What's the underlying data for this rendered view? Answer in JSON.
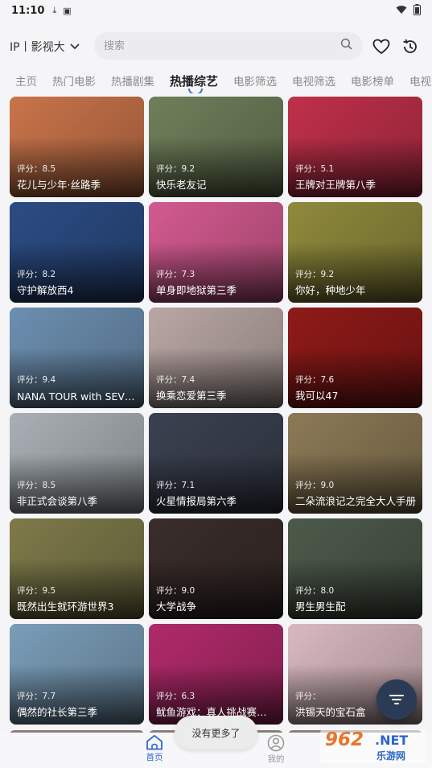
{
  "status_bar": {
    "time": "11:10"
  },
  "header": {
    "source_label": "IP丨影视大",
    "search_placeholder": "搜索"
  },
  "tabs": [
    {
      "label": "主页",
      "active": false
    },
    {
      "label": "热门电影",
      "active": false
    },
    {
      "label": "热播剧集",
      "active": false
    },
    {
      "label": "热播综艺",
      "active": true
    },
    {
      "label": "电影筛选",
      "active": false
    },
    {
      "label": "电视筛选",
      "active": false
    },
    {
      "label": "电影榜单",
      "active": false
    },
    {
      "label": "电视",
      "active": false
    }
  ],
  "cards": [
    {
      "title": "花儿与少年·丝路季",
      "rating": "评分：8.5",
      "color": "#c9744a"
    },
    {
      "title": "快乐老友记",
      "rating": "评分：9.2",
      "color": "#6f7f5a"
    },
    {
      "title": "王牌对王牌第八季",
      "rating": "评分：5.1",
      "color": "#c0304a"
    },
    {
      "title": "守护解放西4",
      "rating": "评分：8.2",
      "color": "#2b4c84"
    },
    {
      "title": "单身即地狱第三季",
      "rating": "评分：7.3",
      "color": "#d35a8f"
    },
    {
      "title": "你好，种地少年",
      "rating": "评分：9.2",
      "color": "#8f8a3c"
    },
    {
      "title": "NANA TOUR with SEVENTEEN",
      "rating": "评分：9.4",
      "color": "#6c8fb0"
    },
    {
      "title": "换乘恋爱第三季",
      "rating": "评分：7.4",
      "color": "#b9a7a4"
    },
    {
      "title": "我可以47",
      "rating": "评分：7.6",
      "color": "#8e1a18"
    },
    {
      "title": "非正式会谈第八季",
      "rating": "评分：8.5",
      "color": "#a9b0b5"
    },
    {
      "title": "火星情报局第六季",
      "rating": "评分：7.1",
      "color": "#3b4150"
    },
    {
      "title": "二朵流浪记之完全大人手册",
      "rating": "评分：9.0",
      "color": "#8c7a56"
    },
    {
      "title": "既然出生就环游世界3",
      "rating": "评分：9.5",
      "color": "#7e7a4a"
    },
    {
      "title": "大学战争",
      "rating": "评分：9.0",
      "color": "#3a2d2b"
    },
    {
      "title": "男生男生配",
      "rating": "评分：8.0",
      "color": "#4d5a4a"
    },
    {
      "title": "偶然的社长第三季",
      "rating": "评分：7.7",
      "color": "#7a9db8"
    },
    {
      "title": "鱿鱼游戏：真人挑战赛第一季",
      "rating": "评分：6.3",
      "color": "#b02a6a"
    },
    {
      "title": "洪锡天的宝石盒",
      "rating": "评分：",
      "color": "#d8b9bf"
    }
  ],
  "toast": "没有更多了",
  "bottom_nav": [
    {
      "label": "首页",
      "active": true
    },
    {
      "label": "我的",
      "active": false
    }
  ],
  "watermark": {
    "number": "962",
    "net": ".NET",
    "sub": "乐游网"
  },
  "colors": {
    "accent": "#2f66d0",
    "fab": "#2b3a55"
  }
}
